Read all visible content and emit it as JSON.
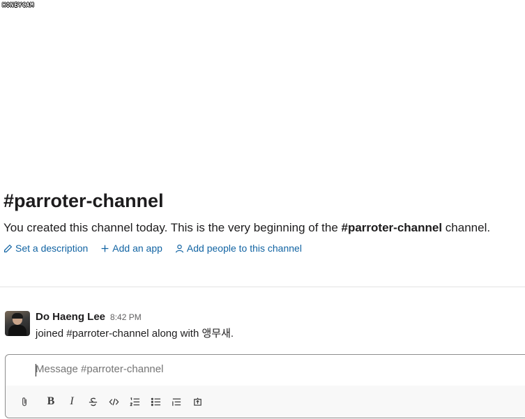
{
  "watermark": "HONEYCAM",
  "channel": {
    "title": "#parroter-channel",
    "desc_prefix": "You created this channel today. This is the very beginning of the",
    "desc_channel": "#parroter-channel",
    "desc_suffix": "channel."
  },
  "actions": {
    "set_description": "Set a description",
    "add_app": "Add an app",
    "add_people": "Add people to this channel"
  },
  "message": {
    "sender": "Do Haeng Lee",
    "time": "8:42 PM",
    "text": "joined #parroter-channel along with 앵무새."
  },
  "composer": {
    "placeholder": "Message #parroter-channel"
  },
  "toolbar": {
    "bold": "B",
    "italic": "I"
  },
  "colors": {
    "link": "#1264a3",
    "text": "#1d1c1d",
    "muted": "#616061"
  }
}
